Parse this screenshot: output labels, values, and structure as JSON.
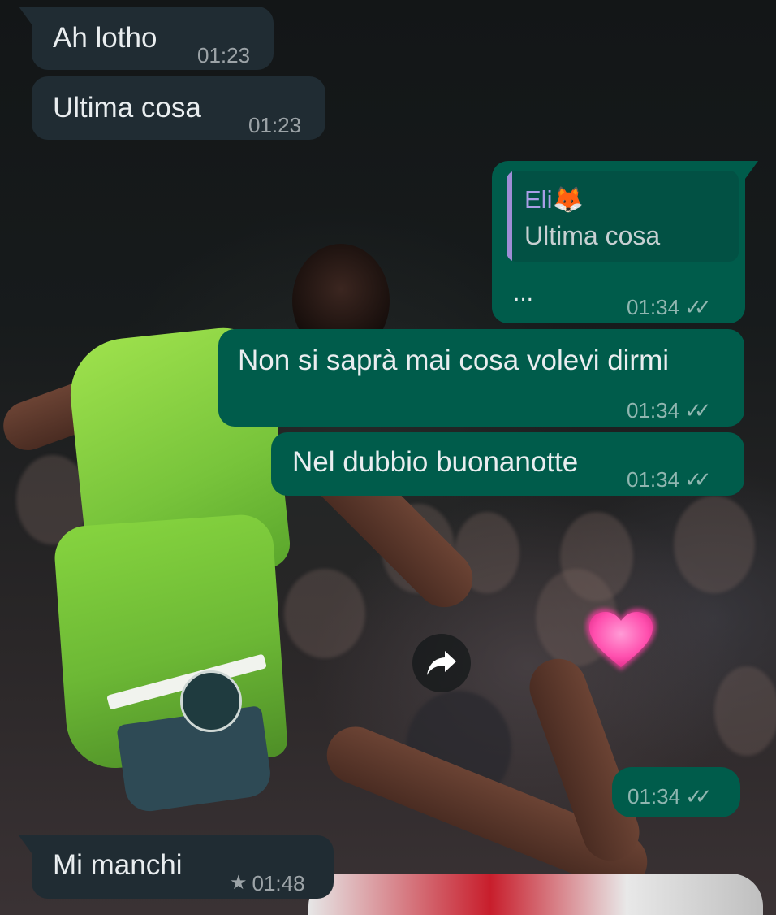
{
  "messages": [
    {
      "id": "m1",
      "direction": "in",
      "text": "Ah lotho",
      "time": "01:23"
    },
    {
      "id": "m2",
      "direction": "in",
      "text": "Ultima cosa",
      "time": "01:23"
    },
    {
      "id": "m3",
      "direction": "out",
      "reply_to": {
        "name": "Eli🦊",
        "text": "Ultima cosa"
      },
      "text": "...",
      "time": "01:34",
      "status": "read"
    },
    {
      "id": "m4",
      "direction": "out",
      "text": "Non si saprà mai cosa volevi dirmi",
      "time": "01:34",
      "status": "read"
    },
    {
      "id": "m5",
      "direction": "out",
      "text": "Nel dubbio buonanotte",
      "time": "01:34",
      "status": "read"
    },
    {
      "id": "m6",
      "direction": "out",
      "media": "image",
      "time": "01:34",
      "status": "read"
    },
    {
      "id": "m7",
      "direction": "in",
      "text": "Mi manchi",
      "time": "01:48",
      "starred": true
    }
  ],
  "icons": {
    "read_ticks": "✓✓",
    "star": "★",
    "forward": "forward-arrow-icon",
    "heart": "heart-sticker"
  },
  "colors": {
    "incoming_bubble": "#202c33",
    "outgoing_bubble": "#005c4b",
    "quote_accent": "#9f8dd6",
    "quote_name": "#a99ee6"
  }
}
